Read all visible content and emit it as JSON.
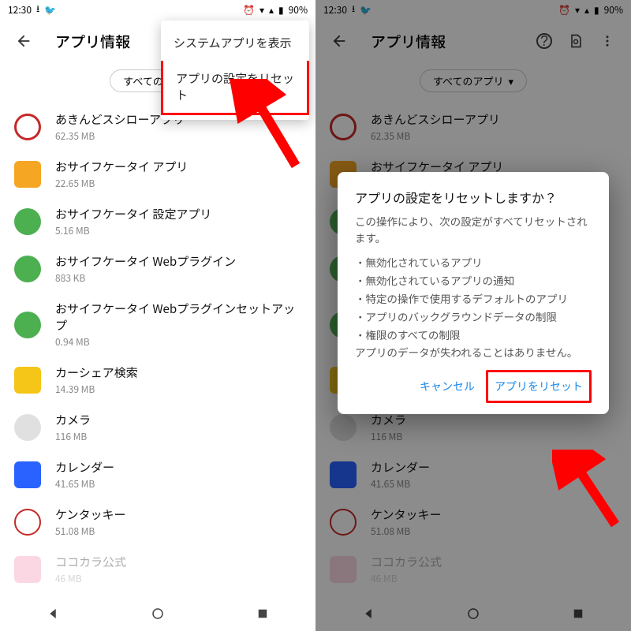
{
  "status": {
    "time": "12:30",
    "battery": "90%"
  },
  "header": {
    "title": "アプリ情報"
  },
  "filter": {
    "label": "すべてのアプリ",
    "label_short": "すべてのアプ..."
  },
  "menu": {
    "show_system": "システムアプリを表示",
    "reset_prefs": "アプリの設定をリセット"
  },
  "apps": [
    {
      "name": "あきんどスシローアプリ",
      "size": "62.35 MB",
      "bg": "#fff",
      "ring": true,
      "txt": "a20"
    },
    {
      "name": "おサイフケータイ アプリ",
      "size": "22.65 MB",
      "bg": "#f5a623",
      "sq": true
    },
    {
      "name": "おサイフケータイ 設定アプリ",
      "size": "5.16 MB",
      "bg": "#4caf50"
    },
    {
      "name": "おサイフケータイ Webプラグイン",
      "size": "883 KB",
      "bg": "#4caf50"
    },
    {
      "name": "おサイフケータイ Webプラグインセットアップ",
      "size": "0.94 MB",
      "bg": "#4caf50"
    },
    {
      "name": "カーシェア検索",
      "size": "14.39 MB",
      "bg": "#f5c518",
      "sq": true
    },
    {
      "name": "カメラ",
      "size": "116 MB",
      "bg": "#e0e0e0"
    },
    {
      "name": "カレンダー",
      "size": "41.65 MB",
      "bg": "#2962ff",
      "sq": true
    },
    {
      "name": "ケンタッキー",
      "size": "51.08 MB",
      "bg": "#fff",
      "ring_red": true
    },
    {
      "name": "ココカラ公式",
      "size": "46 MB",
      "bg": "#f48fb1",
      "sq": true
    }
  ],
  "dialog": {
    "title": "アプリの設定をリセットしますか？",
    "lead": "この操作により、次の設定がすべてリセットされます。",
    "items": [
      "・無効化されているアプリ",
      "・無効化されているアプリの通知",
      "・特定の操作で使用するデフォルトのアプリ",
      "・アプリのバックグラウンドデータの制限",
      "・権限のすべての制限"
    ],
    "tail": "アプリのデータが失われることはありません。",
    "cancel": "キャンセル",
    "confirm": "アプリをリセット"
  }
}
